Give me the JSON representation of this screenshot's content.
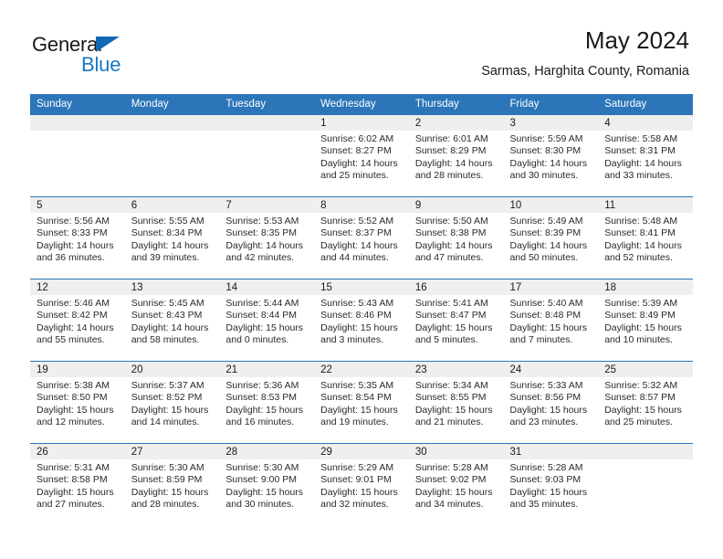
{
  "brand": {
    "name_top": "General",
    "name_bottom": "Blue",
    "triangle_icon": "triangle-icon",
    "accent_color": "#1679c4"
  },
  "header": {
    "title": "May 2024",
    "subtitle": "Sarmas, Harghita County, Romania"
  },
  "calendar": {
    "header_color": "#2b75b8",
    "band_color": "#efefef",
    "weekday_headers": [
      "Sunday",
      "Monday",
      "Tuesday",
      "Wednesday",
      "Thursday",
      "Friday",
      "Saturday"
    ],
    "weeks": [
      [
        {
          "day": "",
          "lines": []
        },
        {
          "day": "",
          "lines": []
        },
        {
          "day": "",
          "lines": []
        },
        {
          "day": "1",
          "lines": [
            "Sunrise: 6:02 AM",
            "Sunset: 8:27 PM",
            "Daylight: 14 hours",
            "and 25 minutes."
          ]
        },
        {
          "day": "2",
          "lines": [
            "Sunrise: 6:01 AM",
            "Sunset: 8:29 PM",
            "Daylight: 14 hours",
            "and 28 minutes."
          ]
        },
        {
          "day": "3",
          "lines": [
            "Sunrise: 5:59 AM",
            "Sunset: 8:30 PM",
            "Daylight: 14 hours",
            "and 30 minutes."
          ]
        },
        {
          "day": "4",
          "lines": [
            "Sunrise: 5:58 AM",
            "Sunset: 8:31 PM",
            "Daylight: 14 hours",
            "and 33 minutes."
          ]
        }
      ],
      [
        {
          "day": "5",
          "lines": [
            "Sunrise: 5:56 AM",
            "Sunset: 8:33 PM",
            "Daylight: 14 hours",
            "and 36 minutes."
          ]
        },
        {
          "day": "6",
          "lines": [
            "Sunrise: 5:55 AM",
            "Sunset: 8:34 PM",
            "Daylight: 14 hours",
            "and 39 minutes."
          ]
        },
        {
          "day": "7",
          "lines": [
            "Sunrise: 5:53 AM",
            "Sunset: 8:35 PM",
            "Daylight: 14 hours",
            "and 42 minutes."
          ]
        },
        {
          "day": "8",
          "lines": [
            "Sunrise: 5:52 AM",
            "Sunset: 8:37 PM",
            "Daylight: 14 hours",
            "and 44 minutes."
          ]
        },
        {
          "day": "9",
          "lines": [
            "Sunrise: 5:50 AM",
            "Sunset: 8:38 PM",
            "Daylight: 14 hours",
            "and 47 minutes."
          ]
        },
        {
          "day": "10",
          "lines": [
            "Sunrise: 5:49 AM",
            "Sunset: 8:39 PM",
            "Daylight: 14 hours",
            "and 50 minutes."
          ]
        },
        {
          "day": "11",
          "lines": [
            "Sunrise: 5:48 AM",
            "Sunset: 8:41 PM",
            "Daylight: 14 hours",
            "and 52 minutes."
          ]
        }
      ],
      [
        {
          "day": "12",
          "lines": [
            "Sunrise: 5:46 AM",
            "Sunset: 8:42 PM",
            "Daylight: 14 hours",
            "and 55 minutes."
          ]
        },
        {
          "day": "13",
          "lines": [
            "Sunrise: 5:45 AM",
            "Sunset: 8:43 PM",
            "Daylight: 14 hours",
            "and 58 minutes."
          ]
        },
        {
          "day": "14",
          "lines": [
            "Sunrise: 5:44 AM",
            "Sunset: 8:44 PM",
            "Daylight: 15 hours",
            "and 0 minutes."
          ]
        },
        {
          "day": "15",
          "lines": [
            "Sunrise: 5:43 AM",
            "Sunset: 8:46 PM",
            "Daylight: 15 hours",
            "and 3 minutes."
          ]
        },
        {
          "day": "16",
          "lines": [
            "Sunrise: 5:41 AM",
            "Sunset: 8:47 PM",
            "Daylight: 15 hours",
            "and 5 minutes."
          ]
        },
        {
          "day": "17",
          "lines": [
            "Sunrise: 5:40 AM",
            "Sunset: 8:48 PM",
            "Daylight: 15 hours",
            "and 7 minutes."
          ]
        },
        {
          "day": "18",
          "lines": [
            "Sunrise: 5:39 AM",
            "Sunset: 8:49 PM",
            "Daylight: 15 hours",
            "and 10 minutes."
          ]
        }
      ],
      [
        {
          "day": "19",
          "lines": [
            "Sunrise: 5:38 AM",
            "Sunset: 8:50 PM",
            "Daylight: 15 hours",
            "and 12 minutes."
          ]
        },
        {
          "day": "20",
          "lines": [
            "Sunrise: 5:37 AM",
            "Sunset: 8:52 PM",
            "Daylight: 15 hours",
            "and 14 minutes."
          ]
        },
        {
          "day": "21",
          "lines": [
            "Sunrise: 5:36 AM",
            "Sunset: 8:53 PM",
            "Daylight: 15 hours",
            "and 16 minutes."
          ]
        },
        {
          "day": "22",
          "lines": [
            "Sunrise: 5:35 AM",
            "Sunset: 8:54 PM",
            "Daylight: 15 hours",
            "and 19 minutes."
          ]
        },
        {
          "day": "23",
          "lines": [
            "Sunrise: 5:34 AM",
            "Sunset: 8:55 PM",
            "Daylight: 15 hours",
            "and 21 minutes."
          ]
        },
        {
          "day": "24",
          "lines": [
            "Sunrise: 5:33 AM",
            "Sunset: 8:56 PM",
            "Daylight: 15 hours",
            "and 23 minutes."
          ]
        },
        {
          "day": "25",
          "lines": [
            "Sunrise: 5:32 AM",
            "Sunset: 8:57 PM",
            "Daylight: 15 hours",
            "and 25 minutes."
          ]
        }
      ],
      [
        {
          "day": "26",
          "lines": [
            "Sunrise: 5:31 AM",
            "Sunset: 8:58 PM",
            "Daylight: 15 hours",
            "and 27 minutes."
          ]
        },
        {
          "day": "27",
          "lines": [
            "Sunrise: 5:30 AM",
            "Sunset: 8:59 PM",
            "Daylight: 15 hours",
            "and 28 minutes."
          ]
        },
        {
          "day": "28",
          "lines": [
            "Sunrise: 5:30 AM",
            "Sunset: 9:00 PM",
            "Daylight: 15 hours",
            "and 30 minutes."
          ]
        },
        {
          "day": "29",
          "lines": [
            "Sunrise: 5:29 AM",
            "Sunset: 9:01 PM",
            "Daylight: 15 hours",
            "and 32 minutes."
          ]
        },
        {
          "day": "30",
          "lines": [
            "Sunrise: 5:28 AM",
            "Sunset: 9:02 PM",
            "Daylight: 15 hours",
            "and 34 minutes."
          ]
        },
        {
          "day": "31",
          "lines": [
            "Sunrise: 5:28 AM",
            "Sunset: 9:03 PM",
            "Daylight: 15 hours",
            "and 35 minutes."
          ]
        },
        {
          "day": "",
          "lines": []
        }
      ]
    ]
  }
}
